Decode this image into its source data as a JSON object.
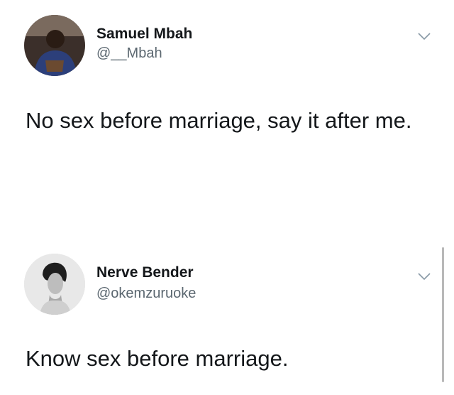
{
  "tweets": [
    {
      "display_name": "Samuel Mbah",
      "handle": "@__Mbah",
      "text": "No sex before marriage, say it after me.",
      "avatar_icon": "user-photo-icon"
    },
    {
      "display_name": "Nerve Bender",
      "handle": "@okemzuruoke",
      "text": "Know sex before marriage.",
      "avatar_icon": "portrait-photo-icon"
    }
  ],
  "colors": {
    "text": "#14171a",
    "secondary": "#5b6770",
    "chevron": "#8899a6"
  }
}
